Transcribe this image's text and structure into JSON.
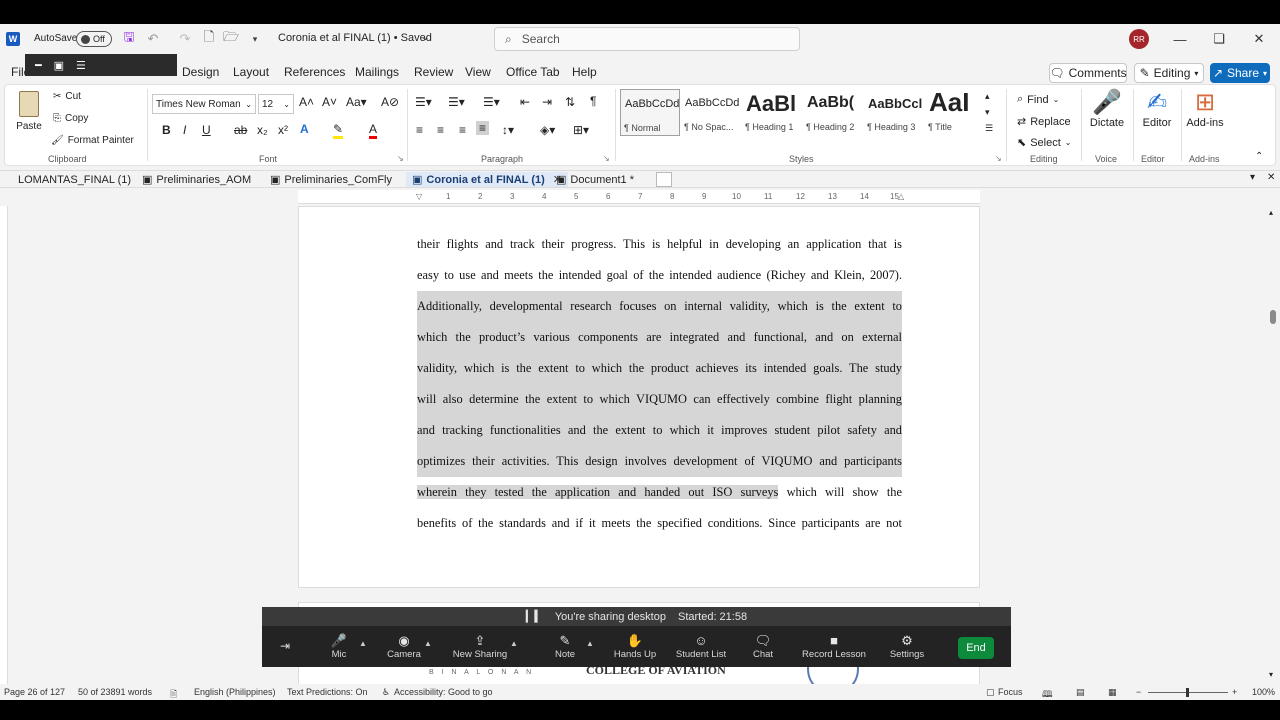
{
  "titlebar": {
    "autosave_label": "AutoSave",
    "autosave_state": "Off",
    "doc_title": "Coronia et al FINAL (1) • Saved",
    "search_placeholder": "Search",
    "avatar_initials": "RR"
  },
  "ribbon_tabs": {
    "file": "File",
    "design": "Design",
    "layout": "Layout",
    "references": "References",
    "mailings": "Mailings",
    "review": "Review",
    "view": "View",
    "office_tab": "Office Tab",
    "help": "Help",
    "comments": "Comments",
    "editing": "Editing",
    "share": "Share"
  },
  "clipboard": {
    "paste": "Paste",
    "cut": "Cut",
    "copy": "Copy",
    "format_painter": "Format Painter",
    "label": "Clipboard"
  },
  "font": {
    "family": "Times New Roman",
    "size": "12",
    "label": "Font"
  },
  "paragraph": {
    "label": "Paragraph"
  },
  "styles": {
    "label": "Styles",
    "items": [
      {
        "sample": "AaBbCcDd",
        "name": "¶ Normal"
      },
      {
        "sample": "AaBbCcDd",
        "name": "¶ No Spac..."
      },
      {
        "sample": "AaBl",
        "name": "¶ Heading 1"
      },
      {
        "sample": "AaBb(",
        "name": "¶ Heading 2"
      },
      {
        "sample": "AaBbCcl",
        "name": "¶ Heading 3"
      },
      {
        "sample": "AaI",
        "name": "¶ Title"
      }
    ]
  },
  "editing_group": {
    "find": "Find",
    "replace": "Replace",
    "select": "Select",
    "label": "Editing"
  },
  "voice": {
    "dictate": "Dictate",
    "label": "Voice"
  },
  "editor": {
    "editor": "Editor",
    "label": "Editor"
  },
  "addins": {
    "addins": "Add-ins",
    "label": "Add-ins"
  },
  "doc_tabs": [
    {
      "label": "LOMANTAS_FINAL (1)"
    },
    {
      "label": "Preliminaries_AOM"
    },
    {
      "label": "Preliminaries_ComFly"
    },
    {
      "label": "Coronia et al FINAL (1)"
    },
    {
      "label": "Document1 *"
    }
  ],
  "ruler_ticks": [
    "1",
    "2",
    "3",
    "4",
    "5",
    "6",
    "7",
    "8",
    "9",
    "10",
    "11",
    "12",
    "13",
    "14",
    "15"
  ],
  "document": {
    "lines": [
      {
        "text": "their flights and track their progress. This is helpful in developing an application that is",
        "hl": ""
      },
      {
        "text": "easy to use and meets the intended goal of the intended audience (Richey and Klein, 2007).",
        "hl": ""
      },
      {
        "text": "Additionally, developmental research focuses on internal validity, which is the extent to",
        "hl": "full"
      },
      {
        "text": "which the product’s various components are integrated and functional, and on external",
        "hl": "full"
      },
      {
        "text": "validity, which is the extent to which the product achieves its intended goals. The study",
        "hl": "full"
      },
      {
        "text": "will also determine the extent to which VIQUMO can effectively combine flight planning",
        "hl": "full"
      },
      {
        "text": "and tracking functionalities and the extent to which it improves student pilot safety and",
        "hl": "full"
      },
      {
        "text": "optimizes their activities. This design involves development of VIQUMO and participants",
        "hl": "full"
      },
      {
        "text_hl": "wherein they tested the application and handed out ISO surveys",
        "text_rest": " which will show the",
        "hl": "partial"
      },
      {
        "text": "benefits of the standards and if it meets the specified conditions. Since participants are not",
        "hl": ""
      }
    ],
    "page2_binalonan": "B I N A L O N A N",
    "page2_college": "COLLEGE OF AVIATION"
  },
  "zoom": {
    "sharing_text": "You're sharing desktop",
    "started": "Started: 21:58",
    "mic": "Mic",
    "camera": "Camera",
    "new_sharing": "New Sharing",
    "note": "Note",
    "hands_up": "Hands Up",
    "student_list": "Student List",
    "chat": "Chat",
    "record": "Record Lesson",
    "settings": "Settings",
    "end": "End"
  },
  "statusbar": {
    "page": "Page 26 of 127",
    "words": "50 of 23891 words",
    "language": "English (Philippines)",
    "predictions": "Text Predictions: On",
    "accessibility": "Accessibility: Good to go",
    "focus": "Focus",
    "zoom": "100%"
  }
}
